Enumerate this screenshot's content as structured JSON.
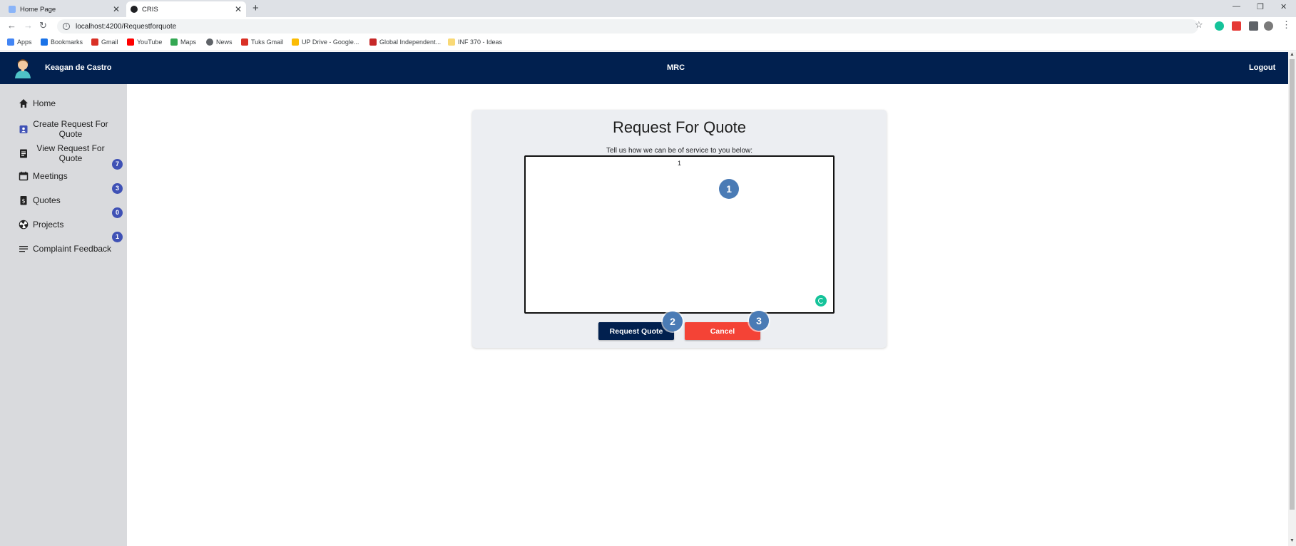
{
  "browser": {
    "tabs": [
      {
        "title": "Home Page"
      },
      {
        "title": "CRIS"
      }
    ],
    "url": "localhost:4200/Requestforquote",
    "bookmarks": [
      {
        "label": "Apps"
      },
      {
        "label": "Bookmarks"
      },
      {
        "label": "Gmail"
      },
      {
        "label": "YouTube"
      },
      {
        "label": "Maps"
      },
      {
        "label": "News"
      },
      {
        "label": "Tuks Gmail"
      },
      {
        "label": "UP Drive - Google..."
      },
      {
        "label": "Global Independent..."
      },
      {
        "label": "INF 370 - Ideas"
      }
    ]
  },
  "header": {
    "username": "Keagan de Castro",
    "title": "MRC",
    "logout": "Logout"
  },
  "sidebar": {
    "items": [
      {
        "label": "Home",
        "icon": "home-icon"
      },
      {
        "label": "Create Request For Quote",
        "icon": "badge-icon"
      },
      {
        "label": "View Request For Quote",
        "icon": "assignment-icon"
      },
      {
        "label": "Meetings",
        "icon": "calendar-icon",
        "badge": "7"
      },
      {
        "label": "Quotes",
        "icon": "receipt-icon",
        "badge": "3"
      },
      {
        "label": "Projects",
        "icon": "radiation-icon",
        "badge": "0"
      },
      {
        "label": "Complaint Feedback",
        "icon": "lines-icon",
        "badge": "1"
      }
    ]
  },
  "main": {
    "title": "Request For Quote",
    "subtitle": "Tell us how we can be of service to you below:",
    "textarea_value": "1",
    "request_button": "Request Quote",
    "cancel_button": "Cancel",
    "markers": [
      "1",
      "2",
      "3"
    ]
  },
  "colors": {
    "header_bg": "#01204f",
    "sidebar_bg": "#d9dadd",
    "badge": "#3f51b5",
    "cancel": "#f44336",
    "marker": "#4a7bb5"
  }
}
